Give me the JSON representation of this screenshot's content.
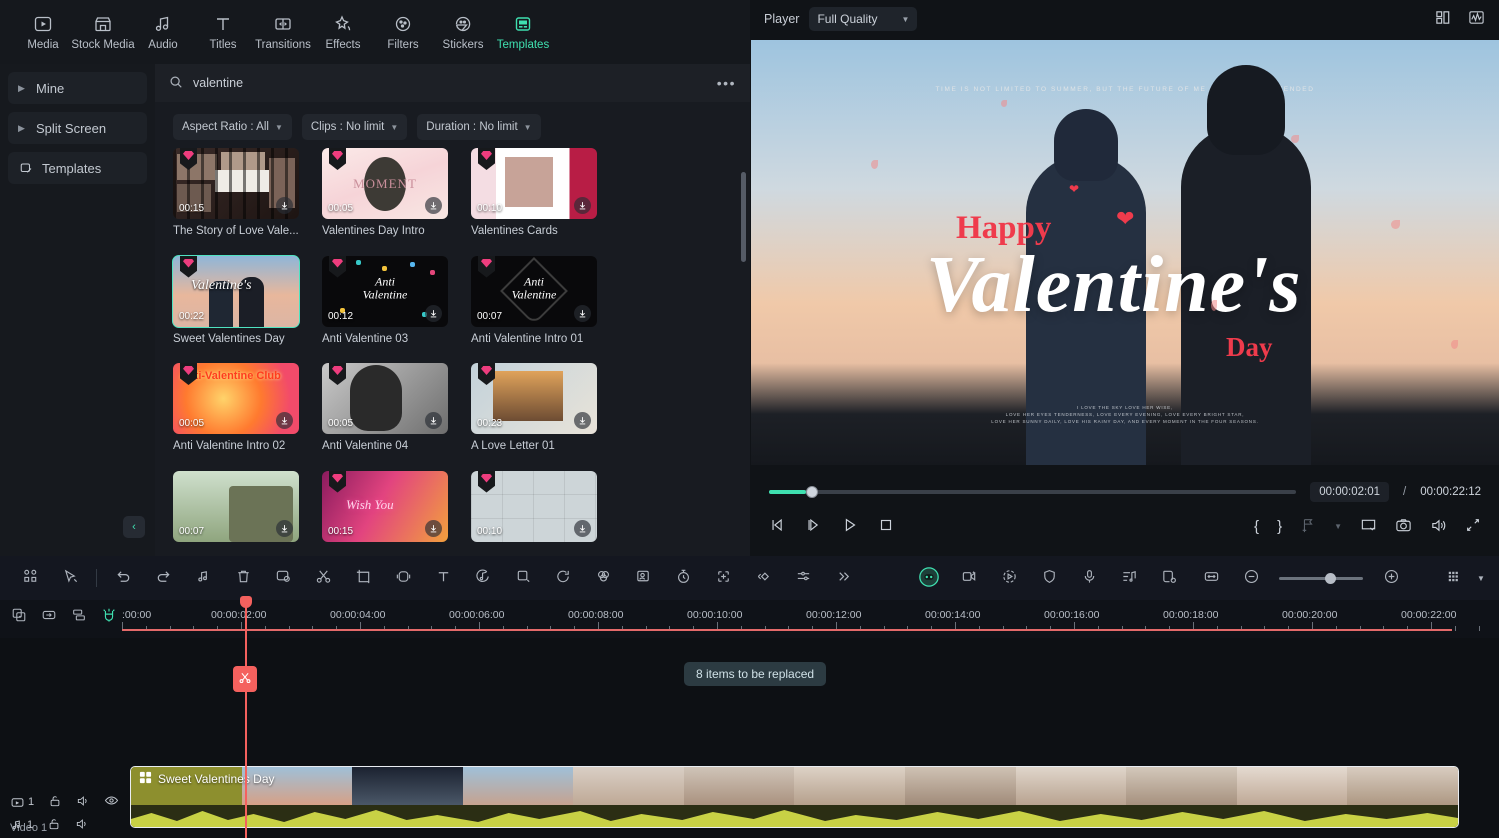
{
  "topnav": {
    "items": [
      {
        "label": "Media",
        "icon": "media-icon",
        "active": false
      },
      {
        "label": "Stock Media",
        "icon": "stock-media-icon",
        "active": false
      },
      {
        "label": "Audio",
        "icon": "audio-icon",
        "active": false
      },
      {
        "label": "Titles",
        "icon": "titles-icon",
        "active": false
      },
      {
        "label": "Transitions",
        "icon": "transitions-icon",
        "active": false
      },
      {
        "label": "Effects",
        "icon": "effects-icon",
        "active": false
      },
      {
        "label": "Filters",
        "icon": "filters-icon",
        "active": false
      },
      {
        "label": "Stickers",
        "icon": "stickers-icon",
        "active": false
      },
      {
        "label": "Templates",
        "icon": "templates-icon",
        "active": true
      }
    ]
  },
  "sidebar": {
    "items": [
      {
        "label": "Mine",
        "icon": "chevron-right-icon"
      },
      {
        "label": "Split Screen",
        "icon": "chevron-right-icon"
      },
      {
        "label": "Templates",
        "icon": "templates-icon"
      }
    ],
    "collapse_label": "‹"
  },
  "browser": {
    "search": {
      "value": "valentine",
      "placeholder": "Search",
      "icon": "search-icon"
    },
    "more_label": "•••",
    "filters": [
      {
        "label": "Aspect Ratio : All"
      },
      {
        "label": "Clips : No limit"
      },
      {
        "label": "Duration : No limit"
      }
    ],
    "cards": [
      {
        "title": "The Story of Love Vale...",
        "duration": "00:15",
        "art": "t1",
        "selected": false
      },
      {
        "title": "Valentines Day Intro",
        "duration": "00:05",
        "art": "t2",
        "selected": false
      },
      {
        "title": "Valentines Cards",
        "duration": "00:10",
        "art": "t3",
        "selected": false
      },
      {
        "title": "Sweet Valentines Day",
        "duration": "00:22",
        "art": "t4",
        "selected": true
      },
      {
        "title": "Anti Valentine 03",
        "duration": "00:12",
        "art": "t5",
        "selected": false
      },
      {
        "title": "Anti Valentine Intro 01",
        "duration": "00:07",
        "art": "t6",
        "selected": false
      },
      {
        "title": "Anti Valentine Intro 02",
        "duration": "00:05",
        "art": "t7",
        "selected": false
      },
      {
        "title": "Anti Valentine 04",
        "duration": "00:05",
        "art": "t8",
        "selected": false
      },
      {
        "title": "A Love Letter 01",
        "duration": "00:23",
        "art": "t9",
        "selected": false
      },
      {
        "title": "",
        "duration": "00:07",
        "art": "t10",
        "selected": false
      },
      {
        "title": "",
        "duration": "00:15",
        "art": "t11",
        "selected": false
      },
      {
        "title": "",
        "duration": "00:10",
        "art": "t12",
        "selected": false
      }
    ]
  },
  "player": {
    "label": "Player",
    "quality": "Full Quality",
    "grid_icon": "layout-grid-icon",
    "chart_icon": "waveform-icon",
    "preview": {
      "top_text": "TIME IS NOT LIMITED TO SUMMER, BUT THE FUTURE OF ME AND YOU IS EXTENDED",
      "headline_small": "Happy",
      "headline_big": "Valentine's",
      "headline_day": "Day",
      "bottom_text": "I LOVE THE SKY LOVE HER WISE,\nLOVE HER EYES TENDERNESS, LOVE EVERY EVENING, LOVE EVERY BRIGHT STAR,\nLOVE HER SUNNY DAILY, LOVE HIS RAINY DAY, AND EVERY MOMENT IN THE FOUR SEASONS."
    },
    "current_time": "00:00:02:01",
    "separator": "/",
    "total_time": "00:00:22:12",
    "progress_percent": 7,
    "controls": [
      {
        "name": "prev-frame-button",
        "icon": "prev-frame-icon"
      },
      {
        "name": "next-frame-button",
        "icon": "next-frame-icon"
      },
      {
        "name": "play-button",
        "icon": "play-icon"
      },
      {
        "name": "stop-button",
        "icon": "stop-icon"
      }
    ],
    "right_controls": [
      {
        "name": "mark-in-button",
        "label": "{"
      },
      {
        "name": "mark-out-button",
        "label": "}"
      },
      {
        "name": "add-marker-button",
        "icon": "marker-icon"
      },
      {
        "name": "marker-dropdown",
        "icon": "chevron-down-icon"
      },
      {
        "name": "pop-out-button",
        "icon": "pop-out-icon"
      },
      {
        "name": "snapshot-button",
        "icon": "camera-icon"
      },
      {
        "name": "volume-button",
        "icon": "speaker-icon"
      },
      {
        "name": "fullscreen-button",
        "icon": "fullscreen-icon"
      }
    ]
  },
  "timeline_toolbar": {
    "left_tools": [
      {
        "name": "layout-button",
        "icon": "grid-icon"
      },
      {
        "name": "select-tool-button",
        "icon": "cursor-icon"
      },
      {
        "name": "undo-button",
        "icon": "undo-icon"
      },
      {
        "name": "redo-button",
        "icon": "redo-icon"
      },
      {
        "name": "auto-beat-sync-button",
        "icon": "music-note-icon"
      },
      {
        "name": "delete-button",
        "icon": "trash-icon"
      },
      {
        "name": "green-screen-button",
        "icon": "chroma-key-icon"
      },
      {
        "name": "split-button",
        "icon": "scissors-icon"
      },
      {
        "name": "crop-button",
        "icon": "crop-icon"
      },
      {
        "name": "speed-button",
        "icon": "speed-icon"
      },
      {
        "name": "text-button",
        "icon": "text-icon"
      },
      {
        "name": "ai-audio-button",
        "icon": "ai-audio-icon"
      },
      {
        "name": "mask-button",
        "icon": "mask-icon"
      },
      {
        "name": "rotate-button",
        "icon": "rotate-icon"
      },
      {
        "name": "color-button",
        "icon": "color-wheel-icon"
      },
      {
        "name": "portrait-button",
        "icon": "portrait-icon"
      },
      {
        "name": "duration-button",
        "icon": "stopwatch-icon"
      },
      {
        "name": "add-to-timeline-button",
        "icon": "add-frame-icon"
      },
      {
        "name": "keyframe-button",
        "icon": "keyframe-icon"
      },
      {
        "name": "adjust-button",
        "icon": "sliders-icon"
      },
      {
        "name": "more-button",
        "icon": "chevron-double-right-icon"
      }
    ],
    "center_tools": [
      {
        "name": "ai-copilot-button",
        "icon": "ai-robot-icon",
        "active": true
      },
      {
        "name": "ai-video-button",
        "icon": "ai-video-icon"
      },
      {
        "name": "auto-reframe-button",
        "icon": "reframe-icon"
      },
      {
        "name": "stabilize-button",
        "icon": "shield-icon"
      },
      {
        "name": "voiceover-button",
        "icon": "microphone-icon"
      },
      {
        "name": "audio-ducking-button",
        "icon": "audio-list-icon"
      },
      {
        "name": "scene-detect-button",
        "icon": "scene-detect-icon"
      }
    ],
    "right_tools": [
      {
        "name": "fit-timeline-button",
        "icon": "fit-icon"
      },
      {
        "name": "zoom-out-button",
        "icon": "minus-circle-icon"
      },
      {
        "name": "zoom-slider",
        "icon": "slider-icon",
        "value": 55
      },
      {
        "name": "zoom-in-button",
        "icon": "plus-circle-icon"
      },
      {
        "name": "track-height-button",
        "icon": "track-height-icon"
      },
      {
        "name": "track-height-dropdown",
        "icon": "chevron-down-icon"
      }
    ]
  },
  "ruler": {
    "icons": [
      {
        "name": "add-track-button",
        "icon": "add-track-icon"
      },
      {
        "name": "link-button",
        "icon": "link-icon"
      },
      {
        "name": "group-button",
        "icon": "group-icon"
      },
      {
        "name": "magnet-button",
        "icon": "magnet-icon",
        "active": true
      }
    ],
    "labels": [
      ":00:00",
      "00:00:02:00",
      "00:00:04:00",
      "00:00:06:00",
      "00:00:08:00",
      "00:00:10:00",
      "00:00:12:00",
      "00:00:14:00",
      "00:00:16:00",
      "00:00:18:00",
      "00:00:20:00",
      "00:00:22:00"
    ]
  },
  "timeline": {
    "video_track": {
      "number": "1",
      "label": "Video 1",
      "icons": [
        "video-track-icon",
        "lock-icon",
        "mute-icon",
        "eye-icon"
      ]
    },
    "audio_track": {
      "number": "1",
      "icons": [
        "audio-track-icon",
        "lock-icon",
        "mute-icon"
      ]
    },
    "clip": {
      "title": "Sweet Valentines Day",
      "icon": "template-clip-icon"
    },
    "tooltip": "8 items to be replaced",
    "split_icon": "scissors-icon"
  },
  "colors": {
    "accent": "#3fe0b0",
    "playhead": "#f4615e",
    "clip": "#8d8f2e",
    "gem": "#ee3d7e"
  }
}
